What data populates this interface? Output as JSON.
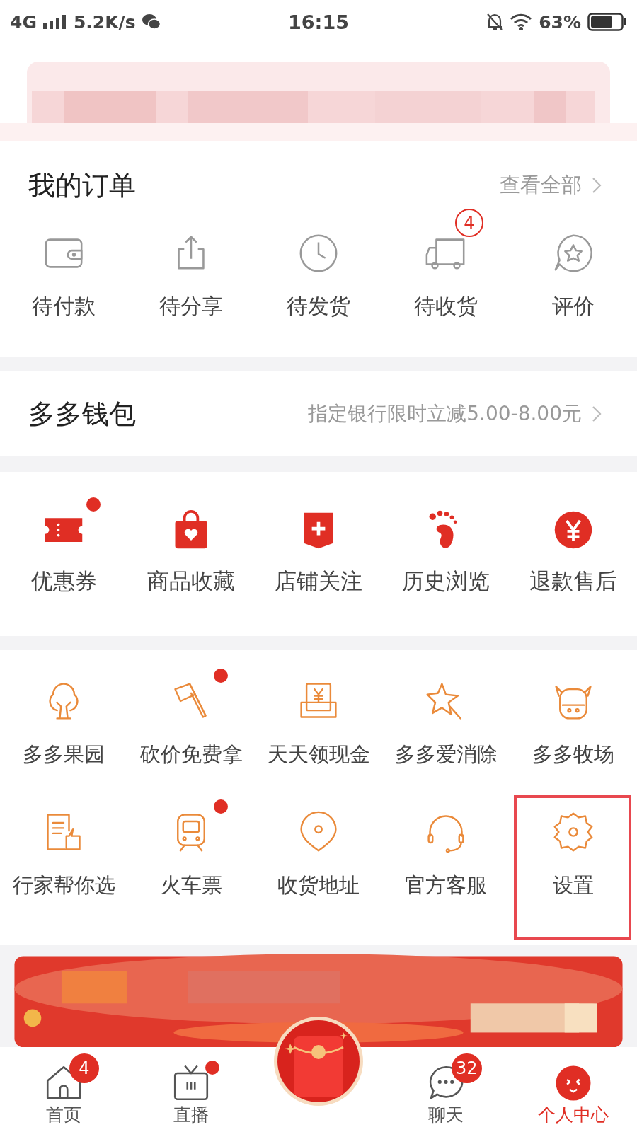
{
  "status_bar": {
    "network": "4G",
    "speed": "5.2K/s",
    "time": "16:15",
    "battery": "63%"
  },
  "orders": {
    "title": "我的订单",
    "link": "查看全部",
    "items": [
      {
        "label": "待付款"
      },
      {
        "label": "待分享"
      },
      {
        "label": "待发货"
      },
      {
        "label": "待收货",
        "badge": "4"
      },
      {
        "label": "评价"
      }
    ]
  },
  "wallet": {
    "title": "多多钱包",
    "promo": "指定银行限时立减5.00-8.00元"
  },
  "shortcuts": [
    {
      "label": "优惠券",
      "dot": true
    },
    {
      "label": "商品收藏",
      "dot": false
    },
    {
      "label": "店铺关注",
      "dot": false
    },
    {
      "label": "历史浏览",
      "dot": false
    },
    {
      "label": "退款售后",
      "dot": false
    }
  ],
  "services": [
    {
      "label": "多多果园",
      "dot": false,
      "highlighted": false
    },
    {
      "label": "砍价免费拿",
      "dot": true,
      "highlighted": false
    },
    {
      "label": "天天领现金",
      "dot": false,
      "highlighted": false
    },
    {
      "label": "多多爱消除",
      "dot": false,
      "highlighted": false
    },
    {
      "label": "多多牧场",
      "dot": false,
      "highlighted": false
    },
    {
      "label": "行家帮你选",
      "dot": false,
      "highlighted": false
    },
    {
      "label": "火车票",
      "dot": true,
      "highlighted": false
    },
    {
      "label": "收货地址",
      "dot": false,
      "highlighted": false
    },
    {
      "label": "官方客服",
      "dot": false,
      "highlighted": false
    },
    {
      "label": "设置",
      "dot": false,
      "highlighted": true
    }
  ],
  "tabs": [
    {
      "label": "首页",
      "badge": "4",
      "dot": false,
      "selected": false
    },
    {
      "label": "直播",
      "dot": true,
      "selected": false
    },
    {
      "kind": "center"
    },
    {
      "label": "聊天",
      "badge": "32",
      "dot": false,
      "selected": false
    },
    {
      "label": "个人中心",
      "dot": false,
      "selected": true
    }
  ]
}
